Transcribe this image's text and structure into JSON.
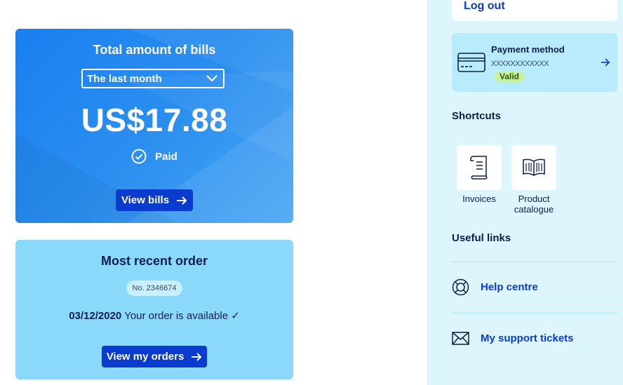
{
  "bills": {
    "title": "Total amount of bills",
    "period_selected": "The last month",
    "amount": "US$17.88",
    "status": "Paid",
    "view_button": "View bills"
  },
  "order": {
    "title": "Most recent order",
    "number": "No. 2346674",
    "date": "03/12/2020",
    "status_text": "Your order is available ✓",
    "view_button": "View my orders"
  },
  "account": {
    "logout": "Log out"
  },
  "payment": {
    "title": "Payment method",
    "card_number": "XXXXXXXXXXXX",
    "status": "Valid"
  },
  "shortcuts": {
    "heading": "Shortcuts",
    "items": [
      {
        "label": "Invoices",
        "icon": "invoice-icon"
      },
      {
        "label": "Product catalogue",
        "icon": "book-icon"
      }
    ]
  },
  "useful_links": {
    "heading": "Useful links",
    "items": [
      {
        "label": "Help centre",
        "icon": "lifebuoy-icon"
      },
      {
        "label": "My support tickets",
        "icon": "envelope-icon"
      }
    ]
  },
  "colors": {
    "primary_blue": "#1a7ff0",
    "button_dark": "#0a3bcf",
    "order_card": "#8ad9fb",
    "sidebar_bg": "#ddf6fe",
    "valid_badge": "#c8f0a0"
  }
}
